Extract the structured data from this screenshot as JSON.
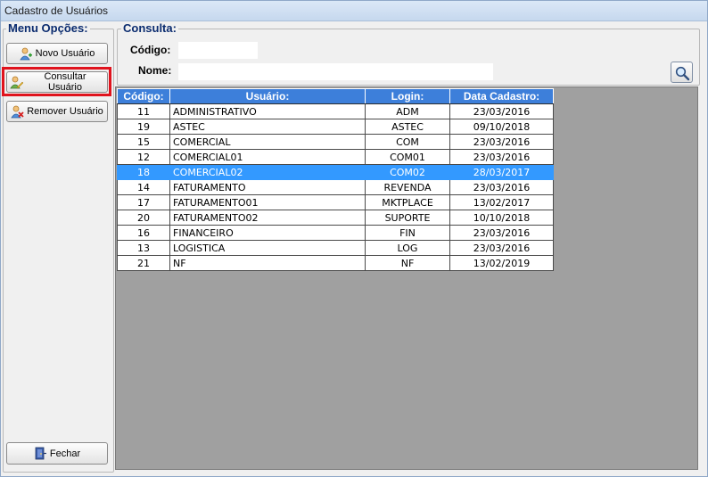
{
  "window": {
    "title": "Cadastro de Usuários"
  },
  "menu": {
    "legend": "Menu Opções:",
    "buttons": [
      {
        "label": "Novo Usuário",
        "icon": "user-add-icon"
      },
      {
        "label": "Consultar Usuário",
        "icon": "user-search-icon"
      },
      {
        "label": "Remover Usuário",
        "icon": "user-remove-icon"
      }
    ],
    "close_label": "Fechar",
    "close_icon": "door-exit-icon"
  },
  "consulta": {
    "legend": "Consulta:",
    "codigo_label": "Código:",
    "codigo_value": "",
    "nome_label": "Nome:",
    "nome_value": "",
    "search_icon": "magnifier-icon"
  },
  "grid": {
    "columns": [
      "Código:",
      "Usuário:",
      "Login:",
      "Data Cadastro:"
    ],
    "selected_index": 4,
    "rows": [
      {
        "codigo": "11",
        "usuario": "ADMINISTRATIVO",
        "login": "ADM",
        "data": "23/03/2016"
      },
      {
        "codigo": "19",
        "usuario": "ASTEC",
        "login": "ASTEC",
        "data": "09/10/2018"
      },
      {
        "codigo": "15",
        "usuario": "COMERCIAL",
        "login": "COM",
        "data": "23/03/2016"
      },
      {
        "codigo": "12",
        "usuario": "COMERCIAL01",
        "login": "COM01",
        "data": "23/03/2016"
      },
      {
        "codigo": "18",
        "usuario": "COMERCIAL02",
        "login": "COM02",
        "data": "28/03/2017"
      },
      {
        "codigo": "14",
        "usuario": "FATURAMENTO",
        "login": "REVENDA",
        "data": "23/03/2016"
      },
      {
        "codigo": "17",
        "usuario": "FATURAMENTO01",
        "login": "MKTPLACE",
        "data": "13/02/2017"
      },
      {
        "codigo": "20",
        "usuario": "FATURAMENTO02",
        "login": "SUPORTE",
        "data": "10/10/2018"
      },
      {
        "codigo": "16",
        "usuario": "FINANCEIRO",
        "login": "FIN",
        "data": "23/03/2016"
      },
      {
        "codigo": "13",
        "usuario": "LOGISTICA",
        "login": "LOG",
        "data": "23/03/2016"
      },
      {
        "codigo": "21",
        "usuario": "NF",
        "login": "NF",
        "data": "13/02/2019"
      }
    ]
  }
}
